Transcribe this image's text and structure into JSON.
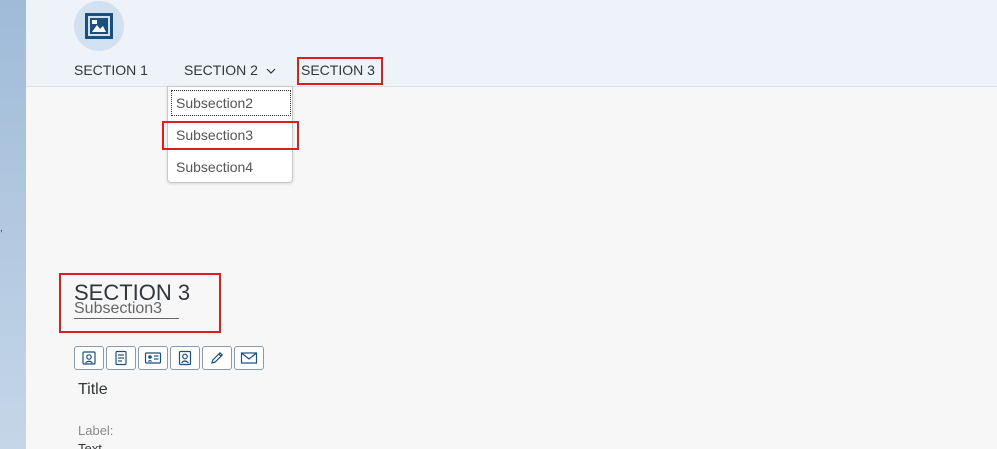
{
  "nav": {
    "tabs": [
      {
        "label": "SECTION 1"
      },
      {
        "label": "SECTION 2"
      },
      {
        "label": "SECTION 3"
      }
    ]
  },
  "dropdown": {
    "items": [
      {
        "label": "Subsection2"
      },
      {
        "label": "Subsection3"
      },
      {
        "label": "Subsection4"
      }
    ]
  },
  "content": {
    "section_title": "SECTION 3",
    "subsection_title": "Subsection3",
    "title": "Title",
    "label": "Label:",
    "value": "Text"
  },
  "toolbar": {
    "icons": [
      "contact-card-icon",
      "checklist-icon",
      "id-card-icon",
      "portrait-icon",
      "pencil-icon",
      "envelope-icon"
    ]
  },
  "colors": {
    "highlight": "#d9201e",
    "header_bg": "#edf3f8",
    "icon_blue": "#1b4f7e"
  }
}
